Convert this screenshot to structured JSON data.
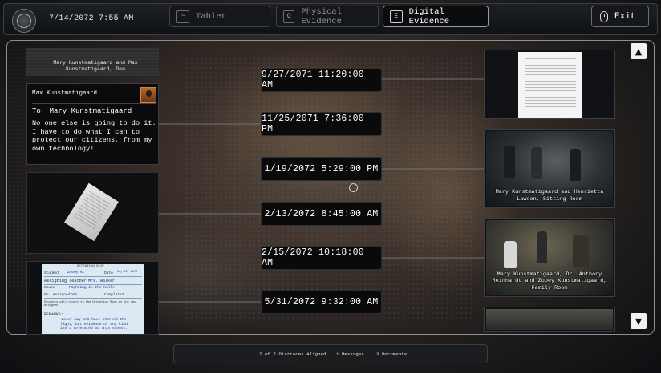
{
  "header": {
    "datetime": "7/14/2072 7:55 AM",
    "tabs": [
      {
        "key": "~",
        "label": "Tablet",
        "active": false
      },
      {
        "key": "Q",
        "label": "Physical Evidence",
        "active": false
      },
      {
        "key": "E",
        "label": "Digital Evidence",
        "active": true
      }
    ],
    "exit_label": "Exit"
  },
  "left_cards": [
    {
      "caption": "Mary Kunstmatigaard and Max Kunstmatigaard, Den"
    },
    {
      "from": "Max Kunstmatigaard",
      "to": "To: Mary Kunstmatigaard",
      "body": "No one else is going to do it. I have to do what I can to protect our citizens, from my own technology!"
    },
    {
      "caption": ""
    },
    {
      "slip": {
        "title": "DETENTION SLIP",
        "student_label": "Student",
        "student_value": "Zooey K.",
        "date_label": "Date",
        "date_value": "May 13, 2072",
        "teacher_label": "Assigning Teacher",
        "teacher_value": "Mrs. Walker",
        "cause_label": "Cause",
        "cause_value": "Fighting in the halls",
        "assigned_label": "No. Assigned",
        "assigned_value": "One",
        "complete_label": "Complete?",
        "notice": "Students will report to the Detention Room on the day assigned.",
        "remarks_label": "REMARKS:",
        "remarks": "Zooey may not have started the fight, but evidence of any kind isn't tolerated at this school."
      }
    }
  ],
  "timeline": {
    "dates": [
      "9/27/2071 11:20:00 AM",
      "11/25/2071 7:36:00 PM",
      "1/19/2072 5:29:00 PM",
      "2/13/2072 8:45:00 AM",
      "2/15/2072 10:18:00 AM",
      "5/31/2072 9:32:00 AM"
    ]
  },
  "right_cards": [
    {
      "caption": ""
    },
    {
      "caption": "Mary Kunstmatigaard and Henrietta Lawson, Sitting Room"
    },
    {
      "caption": "Mary Kunstmatigaard, Dr. Anthony Reinhardt and Zooey Kunstmatigaard, Family Room"
    },
    {
      "caption": ""
    }
  ],
  "status": {
    "distraces": "7 of 7 Distraces Aligned",
    "messages": "1 Messages",
    "documents": "3 Documents"
  },
  "icons": {
    "scroll_up": "▲",
    "scroll_down": "▼"
  }
}
